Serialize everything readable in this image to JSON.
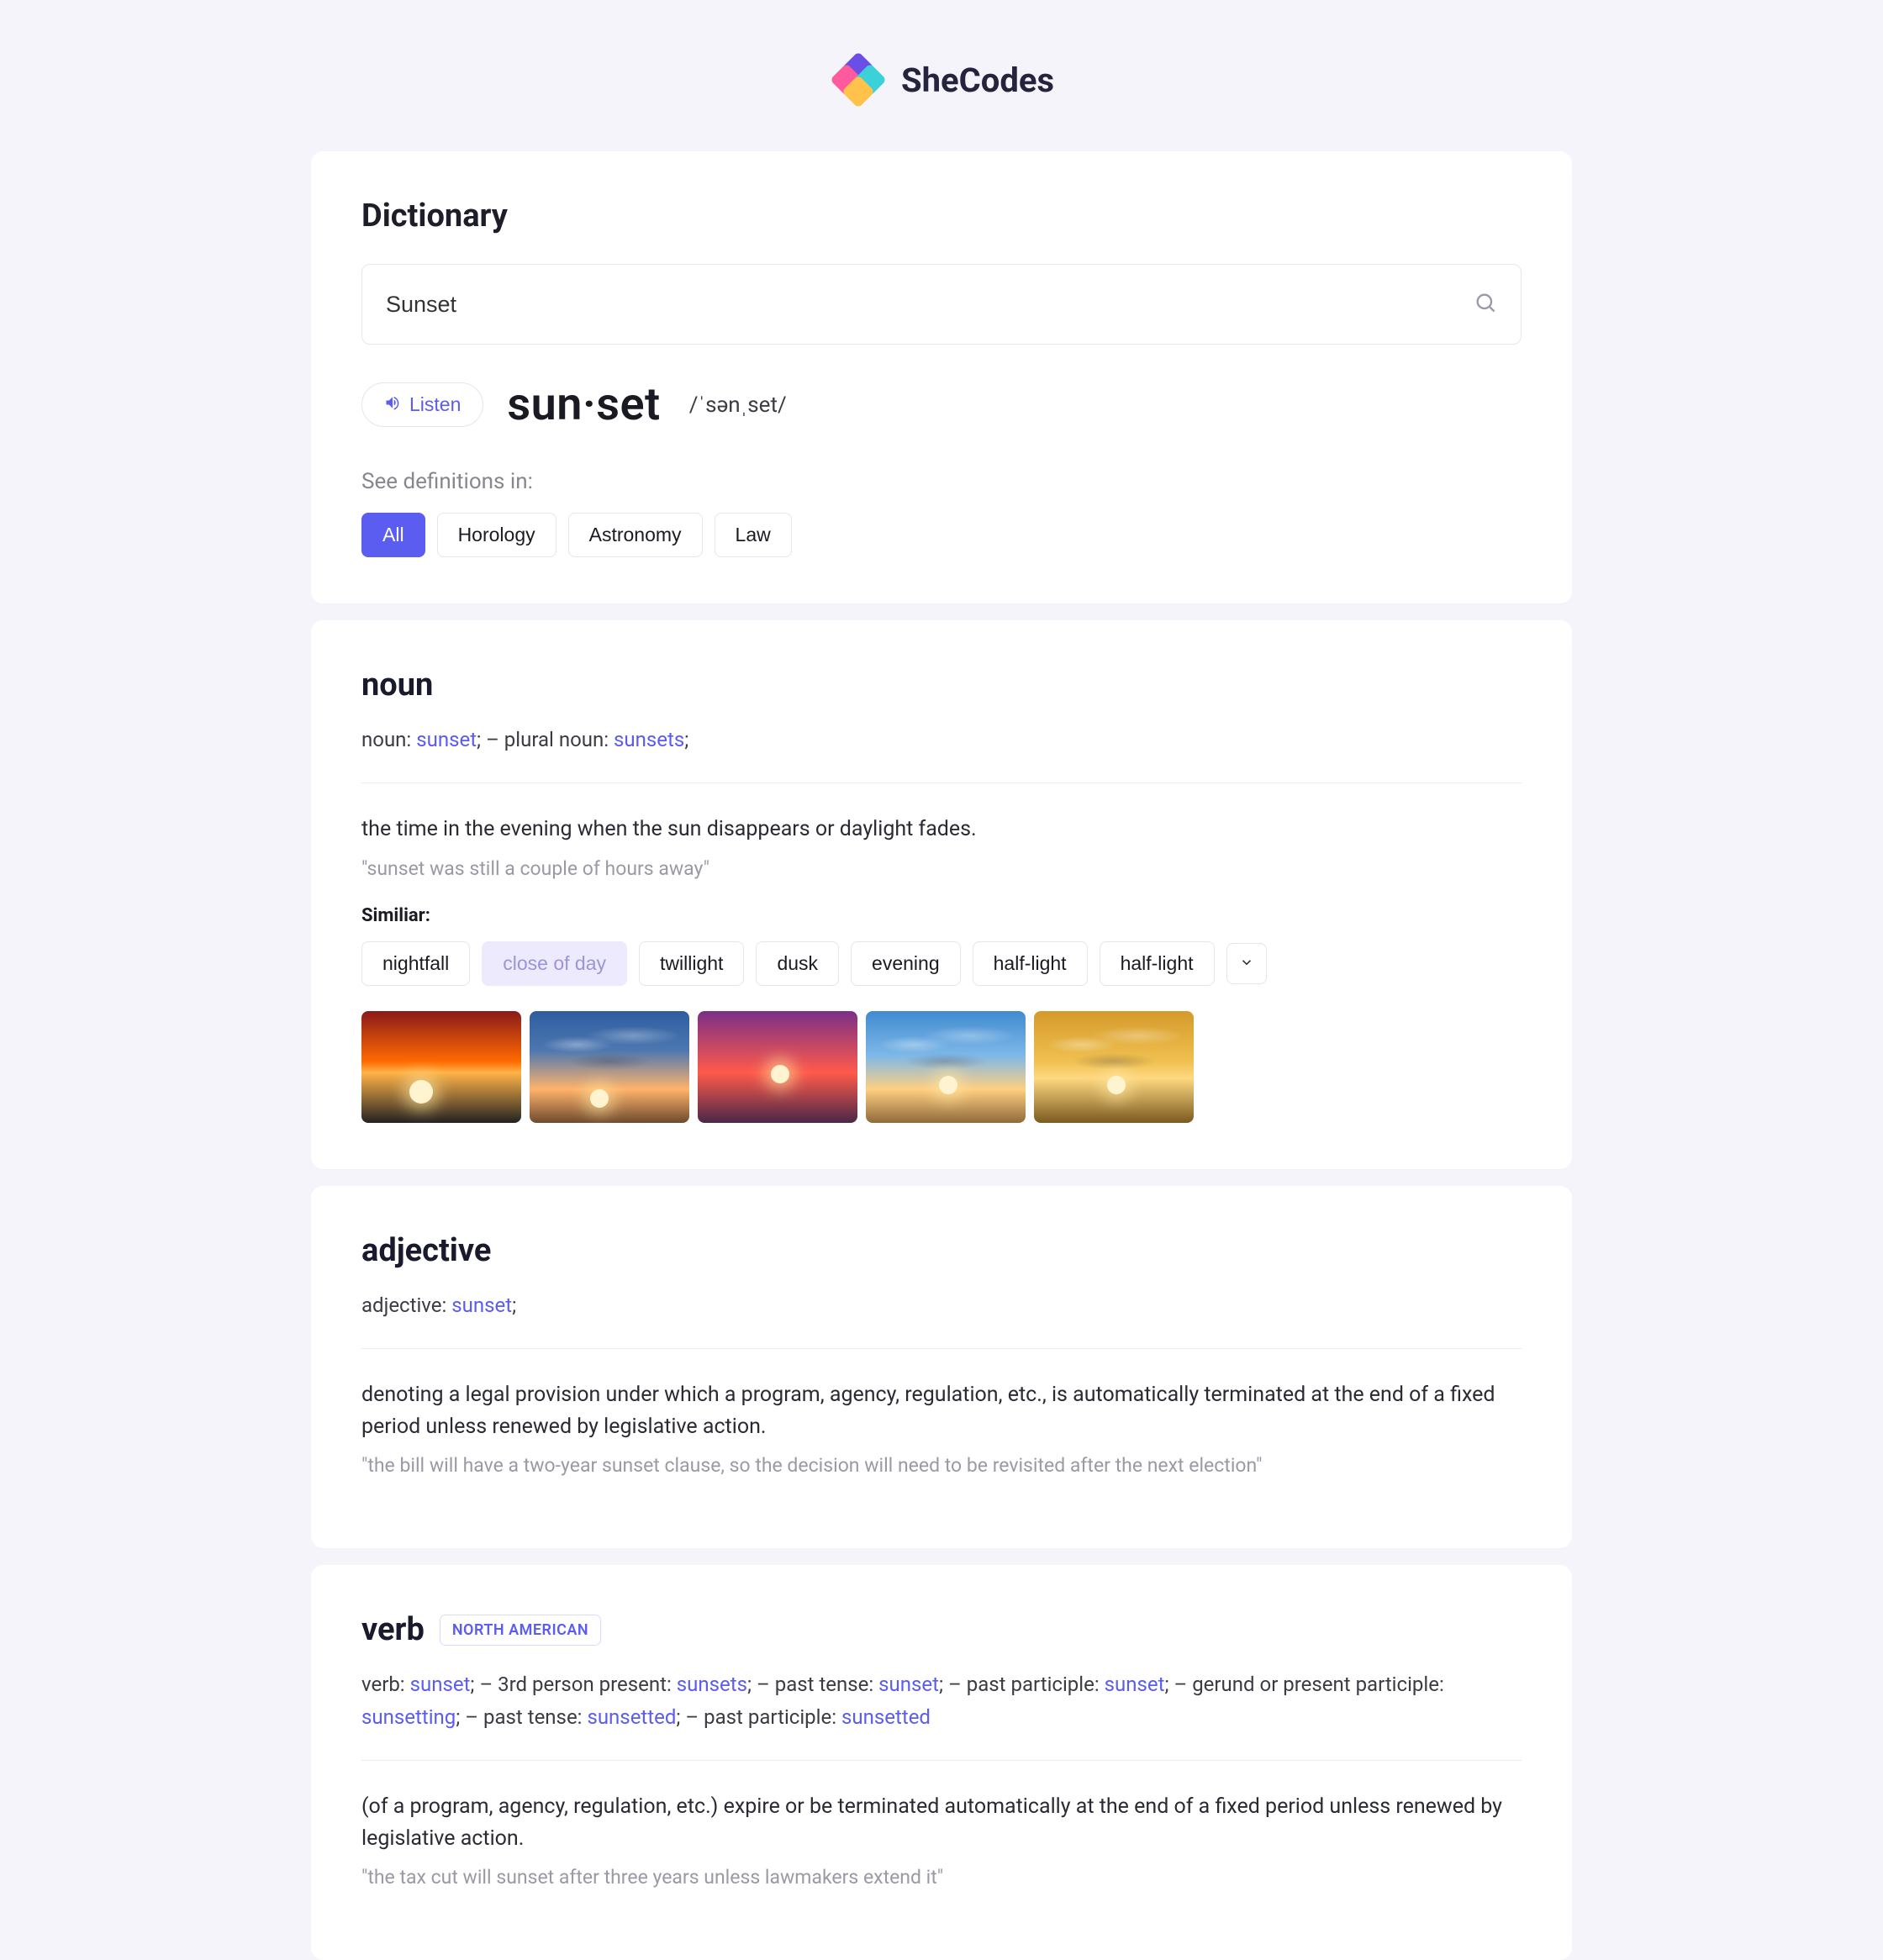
{
  "brand": {
    "name": "SheCodes"
  },
  "header": {
    "title": "Dictionary",
    "search_value": "Sunset",
    "search_placeholder": "Search"
  },
  "result": {
    "listen_label": "Listen",
    "headword": "sun·set",
    "pronunciation": "/ˈsənˌset/",
    "see_label": "See definitions in:",
    "categories": [
      {
        "label": "All",
        "active": true
      },
      {
        "label": "Horology",
        "active": false
      },
      {
        "label": "Astronomy",
        "active": false
      },
      {
        "label": "Law",
        "active": false
      }
    ]
  },
  "noun": {
    "title": "noun",
    "forms_prefix": "noun: ",
    "forms_word": "sunset",
    "forms_sep": ";   –   plural noun: ",
    "forms_word2": "sunsets",
    "forms_tail": ";",
    "definition": "the time in the evening when the sun disappears or daylight fades.",
    "example": "\"sunset was still a couple of hours away\"",
    "similar_label": "Similiar:",
    "similar": [
      "nightfall",
      "close of day",
      "twillight",
      "dusk",
      "evening",
      "half-light",
      "half-light"
    ],
    "similar_soft_index": 1
  },
  "adjective": {
    "title": "adjective",
    "forms_prefix": "adjective: ",
    "forms_word": "sunset",
    "forms_tail": ";",
    "definition": "denoting a legal provision under which a program, agency, regulation, etc., is automatically terminated at the end of a fixed period unless renewed by legislative action.",
    "example": "\"the bill will have a two-year sunset clause, so the decision will need to be revisited after the next election\""
  },
  "verb": {
    "title": "verb",
    "region": "NORTH AMERICAN",
    "forms": [
      {
        "label": "verb: ",
        "word": "sunset",
        "tail": ";   –   "
      },
      {
        "label": "3rd person present: ",
        "word": "sunsets",
        "tail": ";   –   "
      },
      {
        "label": "past tense: ",
        "word": "sunset",
        "tail": ";   –   "
      },
      {
        "label": "past participle: ",
        "word": "sunset",
        "tail": ";   –   "
      },
      {
        "label": "gerund or present participle: ",
        "word": "sunsetting",
        "tail": ";   –   "
      },
      {
        "label": "past tense: ",
        "word": "sunsetted",
        "tail": ";   –   "
      },
      {
        "label": "past participle: ",
        "word": "sunsetted",
        "tail": ""
      }
    ],
    "definition": "(of a program, agency, regulation, etc.) expire or be terminated automatically at the end of a fixed period unless renewed by legislative action.",
    "example": "\"the tax cut will sunset after three years unless lawmakers extend it\""
  }
}
